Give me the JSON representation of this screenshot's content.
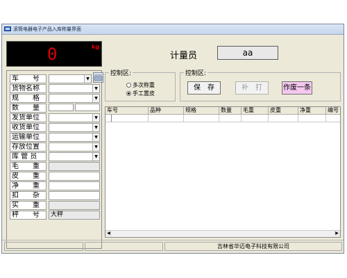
{
  "window": {
    "title": "滚筒电器电子产品入库称量界面"
  },
  "weight": {
    "value": "0",
    "unit": "kg"
  },
  "form": {
    "rows": [
      {
        "label": "车　　号",
        "value": "",
        "dropdown": true,
        "readonly": false
      },
      {
        "label": "货物名称",
        "value": "",
        "dropdown": true,
        "readonly": false
      },
      {
        "label": "规　　格",
        "value": "",
        "dropdown": true,
        "readonly": false
      },
      {
        "label": "数　　量",
        "value": "",
        "dropdown": false,
        "readonly": false
      },
      {
        "label": "发货单位",
        "value": "",
        "dropdown": true,
        "readonly": false
      },
      {
        "label": "收货单位",
        "value": "",
        "dropdown": true,
        "readonly": false
      },
      {
        "label": "运输单位",
        "value": "",
        "dropdown": true,
        "readonly": false
      },
      {
        "label": "存放位置",
        "value": "",
        "dropdown": true,
        "readonly": false
      },
      {
        "label": "库 管 员",
        "value": "",
        "dropdown": true,
        "readonly": false
      },
      {
        "label": "毛　　重",
        "value": "",
        "dropdown": false,
        "readonly": true
      },
      {
        "label": "皮　　重",
        "value": "",
        "dropdown": false,
        "readonly": false
      },
      {
        "label": "净　　重",
        "value": "",
        "dropdown": false,
        "readonly": false
      },
      {
        "label": "扣　　杂",
        "value": "",
        "dropdown": false,
        "readonly": false
      },
      {
        "label": "实　　重",
        "value": "",
        "dropdown": false,
        "readonly": true
      },
      {
        "label": "秤　　号",
        "value": "大秤",
        "dropdown": false,
        "readonly": true
      }
    ]
  },
  "operator": {
    "label": "计量员",
    "value": "aa"
  },
  "control_left": {
    "title": "控制区:",
    "options": [
      {
        "label": "多次称重",
        "selected": false
      },
      {
        "label": "手工置皮",
        "selected": true
      }
    ]
  },
  "control_right": {
    "title": "控制区:",
    "save_label": "保　存",
    "supplement_label": "补　打",
    "void_label": "作废一条"
  },
  "colors": {
    "void_button_bg": "#f5c8f0",
    "display_red": "#e00000"
  },
  "table": {
    "columns": [
      "车号",
      "品种",
      "规格",
      "数量",
      "毛重",
      "皮重",
      "净重",
      "编号"
    ]
  },
  "status": {
    "company": "吉林省华迈电子科技有限公司"
  }
}
